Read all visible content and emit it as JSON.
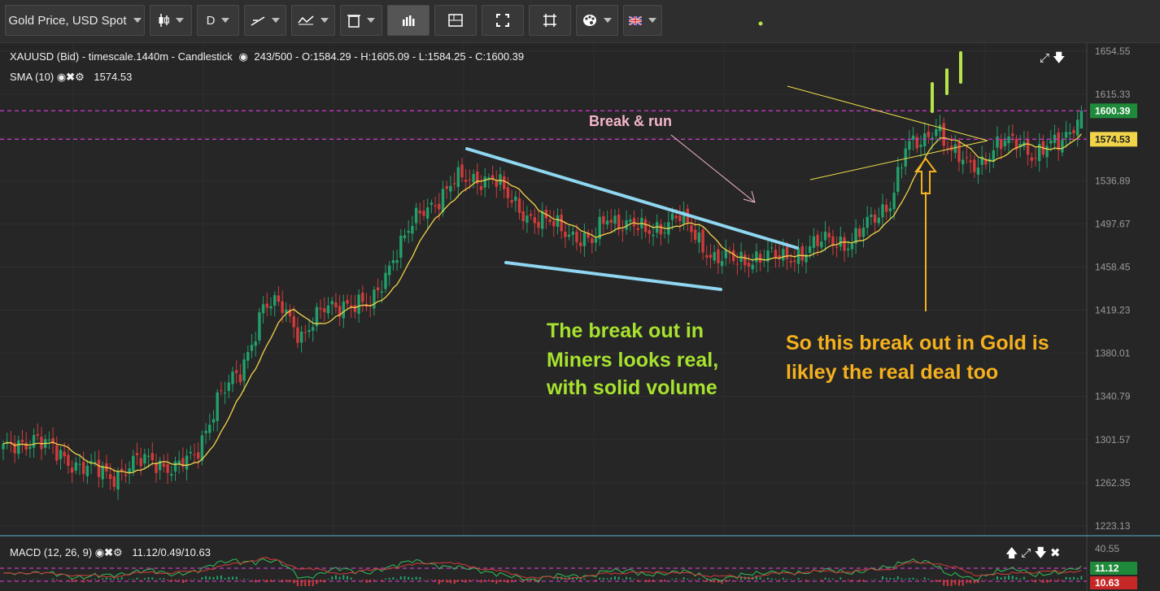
{
  "toolbar": {
    "symbol_label": "Gold Price, USD Spot",
    "timeframe_label": "D",
    "flag_icon": "uk-flag-icon"
  },
  "legend": {
    "price": "XAUUSD (Bid) - timescale.1440m - Candlestick",
    "counter": "243/500 - O:1584.29 - H:1605.09 - L:1584.25 - C:1600.39",
    "sma_name": "SMA (10)",
    "sma_value": "1574.53",
    "macd_name": "MACD (12, 26, 9)",
    "macd_values": "11.12/0.49/10.63"
  },
  "colors": {
    "bg": "#262626",
    "up": "#22a06b",
    "down": "#d33a3a",
    "sma": "#f2d44a",
    "trend": "#8fd6f0",
    "triangle": "#f0e04a",
    "guide": "#c239c2",
    "green_text": "#a6e22e",
    "orange_text": "#f5b01e",
    "pink_text": "#f4b6c8"
  },
  "chart_data": {
    "type": "candlestick",
    "y_ticks": [
      "1654.55",
      "1615.33",
      "1576.11",
      "1536.89",
      "1497.67",
      "1458.45",
      "1419.23",
      "1380.01",
      "1340.79",
      "1301.57",
      "1262.35",
      "1223.13"
    ],
    "y_range": [
      1223.13,
      1654.55
    ],
    "last_price_label": "1600.39",
    "sma_price_label": "1574.53",
    "last": {
      "open": 1584.29,
      "high": 1605.09,
      "low": 1584.25,
      "close": 1600.39
    },
    "anchors": [
      [
        0,
        1290
      ],
      [
        8,
        1305
      ],
      [
        14,
        1288
      ],
      [
        22,
        1276
      ],
      [
        28,
        1268
      ],
      [
        34,
        1280
      ],
      [
        40,
        1282
      ],
      [
        45,
        1276
      ],
      [
        50,
        1284
      ],
      [
        56,
        1340
      ],
      [
        62,
        1360
      ],
      [
        68,
        1425
      ],
      [
        73,
        1420
      ],
      [
        78,
        1398
      ],
      [
        84,
        1418
      ],
      [
        90,
        1428
      ],
      [
        96,
        1420
      ],
      [
        102,
        1470
      ],
      [
        106,
        1490
      ],
      [
        110,
        1510
      ],
      [
        118,
        1535
      ],
      [
        124,
        1540
      ],
      [
        128,
        1540
      ],
      [
        132,
        1520
      ],
      [
        136,
        1510
      ],
      [
        140,
        1500
      ],
      [
        148,
        1492
      ],
      [
        154,
        1478
      ],
      [
        158,
        1505
      ],
      [
        164,
        1497
      ],
      [
        168,
        1488
      ],
      [
        176,
        1505
      ],
      [
        180,
        1490
      ],
      [
        186,
        1468
      ],
      [
        192,
        1462
      ],
      [
        198,
        1470
      ],
      [
        204,
        1465
      ],
      [
        210,
        1475
      ],
      [
        216,
        1482
      ],
      [
        222,
        1482
      ],
      [
        228,
        1502
      ],
      [
        232,
        1520
      ],
      [
        236,
        1565
      ],
      [
        240,
        1570
      ],
      [
        244,
        1590
      ],
      [
        248,
        1560
      ],
      [
        252,
        1552
      ],
      [
        256,
        1556
      ],
      [
        262,
        1570
      ],
      [
        266,
        1575
      ],
      [
        270,
        1558
      ],
      [
        276,
        1572
      ],
      [
        279,
        1585
      ],
      [
        282,
        1600
      ]
    ],
    "macd_ticks": [
      "40.55"
    ],
    "macd_labels": [
      "11.12",
      "10.63"
    ],
    "annotations": {
      "break_run": "Break & run",
      "miners_1": "The break out in",
      "miners_2": "Miners looks real,",
      "miners_3": "with solid volume",
      "gold_1": "So this break out in Gold is",
      "gold_2": "likley the real deal too"
    }
  }
}
